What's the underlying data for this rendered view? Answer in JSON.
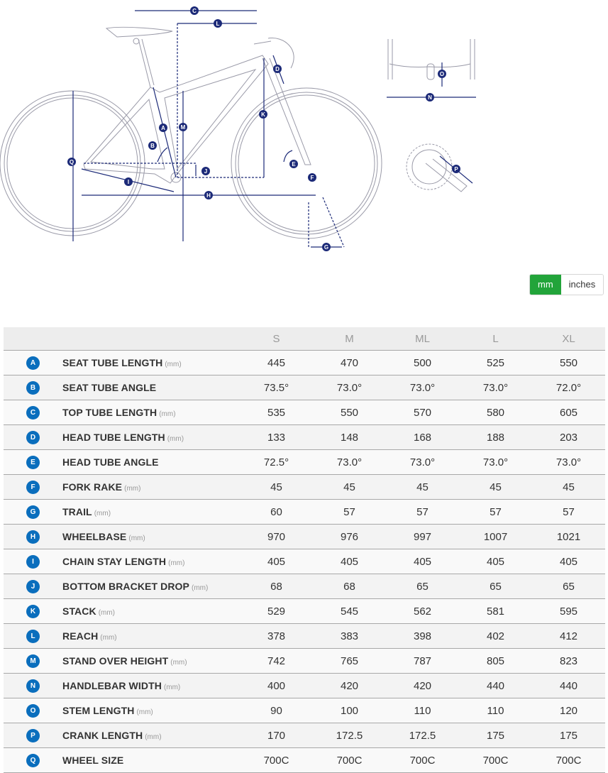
{
  "unit_toggle": {
    "options": [
      "mm",
      "inches"
    ],
    "selected": "mm"
  },
  "diagram": {
    "labels": [
      "A",
      "B",
      "C",
      "D",
      "E",
      "F",
      "G",
      "H",
      "I",
      "J",
      "K",
      "L",
      "M",
      "N",
      "O",
      "P",
      "Q"
    ],
    "line_color": "#1c2a78"
  },
  "table": {
    "sizes": [
      "S",
      "M",
      "ML",
      "L",
      "XL"
    ],
    "rows": [
      {
        "key": "A",
        "name": "SEAT TUBE LENGTH",
        "unit": "(mm)",
        "values": [
          "445",
          "470",
          "500",
          "525",
          "550"
        ]
      },
      {
        "key": "B",
        "name": "SEAT TUBE ANGLE",
        "unit": "",
        "values": [
          "73.5°",
          "73.0°",
          "73.0°",
          "73.0°",
          "72.0°"
        ]
      },
      {
        "key": "C",
        "name": "TOP TUBE LENGTH",
        "unit": "(mm)",
        "values": [
          "535",
          "550",
          "570",
          "580",
          "605"
        ]
      },
      {
        "key": "D",
        "name": "HEAD TUBE LENGTH",
        "unit": "(mm)",
        "values": [
          "133",
          "148",
          "168",
          "188",
          "203"
        ]
      },
      {
        "key": "E",
        "name": "HEAD TUBE ANGLE",
        "unit": "",
        "values": [
          "72.5°",
          "73.0°",
          "73.0°",
          "73.0°",
          "73.0°"
        ]
      },
      {
        "key": "F",
        "name": "FORK RAKE",
        "unit": "(mm)",
        "values": [
          "45",
          "45",
          "45",
          "45",
          "45"
        ]
      },
      {
        "key": "G",
        "name": "TRAIL",
        "unit": "(mm)",
        "values": [
          "60",
          "57",
          "57",
          "57",
          "57"
        ]
      },
      {
        "key": "H",
        "name": "WHEELBASE",
        "unit": "(mm)",
        "values": [
          "970",
          "976",
          "997",
          "1007",
          "1021"
        ]
      },
      {
        "key": "I",
        "name": "CHAIN STAY LENGTH",
        "unit": "(mm)",
        "values": [
          "405",
          "405",
          "405",
          "405",
          "405"
        ]
      },
      {
        "key": "J",
        "name": "BOTTOM BRACKET DROP",
        "unit": "(mm)",
        "values": [
          "68",
          "68",
          "65",
          "65",
          "65"
        ]
      },
      {
        "key": "K",
        "name": "STACK",
        "unit": "(mm)",
        "values": [
          "529",
          "545",
          "562",
          "581",
          "595"
        ]
      },
      {
        "key": "L",
        "name": "REACH",
        "unit": "(mm)",
        "values": [
          "378",
          "383",
          "398",
          "402",
          "412"
        ]
      },
      {
        "key": "M",
        "name": "STAND OVER HEIGHT",
        "unit": "(mm)",
        "values": [
          "742",
          "765",
          "787",
          "805",
          "823"
        ]
      },
      {
        "key": "N",
        "name": "HANDLEBAR WIDTH",
        "unit": "(mm)",
        "values": [
          "400",
          "420",
          "420",
          "440",
          "440"
        ]
      },
      {
        "key": "O",
        "name": "STEM LENGTH",
        "unit": "(mm)",
        "values": [
          "90",
          "100",
          "110",
          "110",
          "120"
        ]
      },
      {
        "key": "P",
        "name": "CRANK LENGTH",
        "unit": "(mm)",
        "values": [
          "170",
          "172.5",
          "172.5",
          "175",
          "175"
        ]
      },
      {
        "key": "Q",
        "name": "WHEEL SIZE",
        "unit": "",
        "values": [
          "700C",
          "700C",
          "700C",
          "700C",
          "700C"
        ]
      }
    ]
  },
  "colors": {
    "badge": "#0a6ebd",
    "toggle_active": "#22a43a",
    "diagram_line": "#1c2a78"
  }
}
